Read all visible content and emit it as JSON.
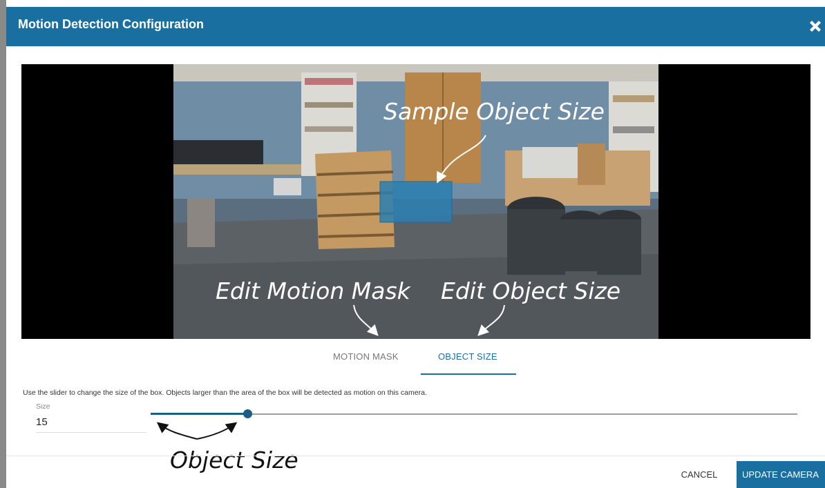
{
  "dialog": {
    "title": "Motion Detection Configuration",
    "close_icon": "close-icon"
  },
  "colors": {
    "primary": "#1a6fa1",
    "slider": "#1a5d85",
    "object_box": "#2a7fb0"
  },
  "annotations": {
    "sample_object_size": "Sample Object Size",
    "edit_motion_mask": "Edit Motion Mask",
    "edit_object_size": "Edit Object Size",
    "object_size": "Object Size"
  },
  "tabs": [
    {
      "label": "MOTION MASK",
      "active": false
    },
    {
      "label": "OBJECT SIZE",
      "active": true
    }
  ],
  "object_size_panel": {
    "help_text": "Use the slider to change the size of the box. Objects larger than the area of the box will be detected as motion on this camera.",
    "size_label": "Size",
    "size_value": "15",
    "slider_fraction": 0.15
  },
  "footer": {
    "cancel_label": "CANCEL",
    "update_label": "UPDATE CAMERA"
  }
}
